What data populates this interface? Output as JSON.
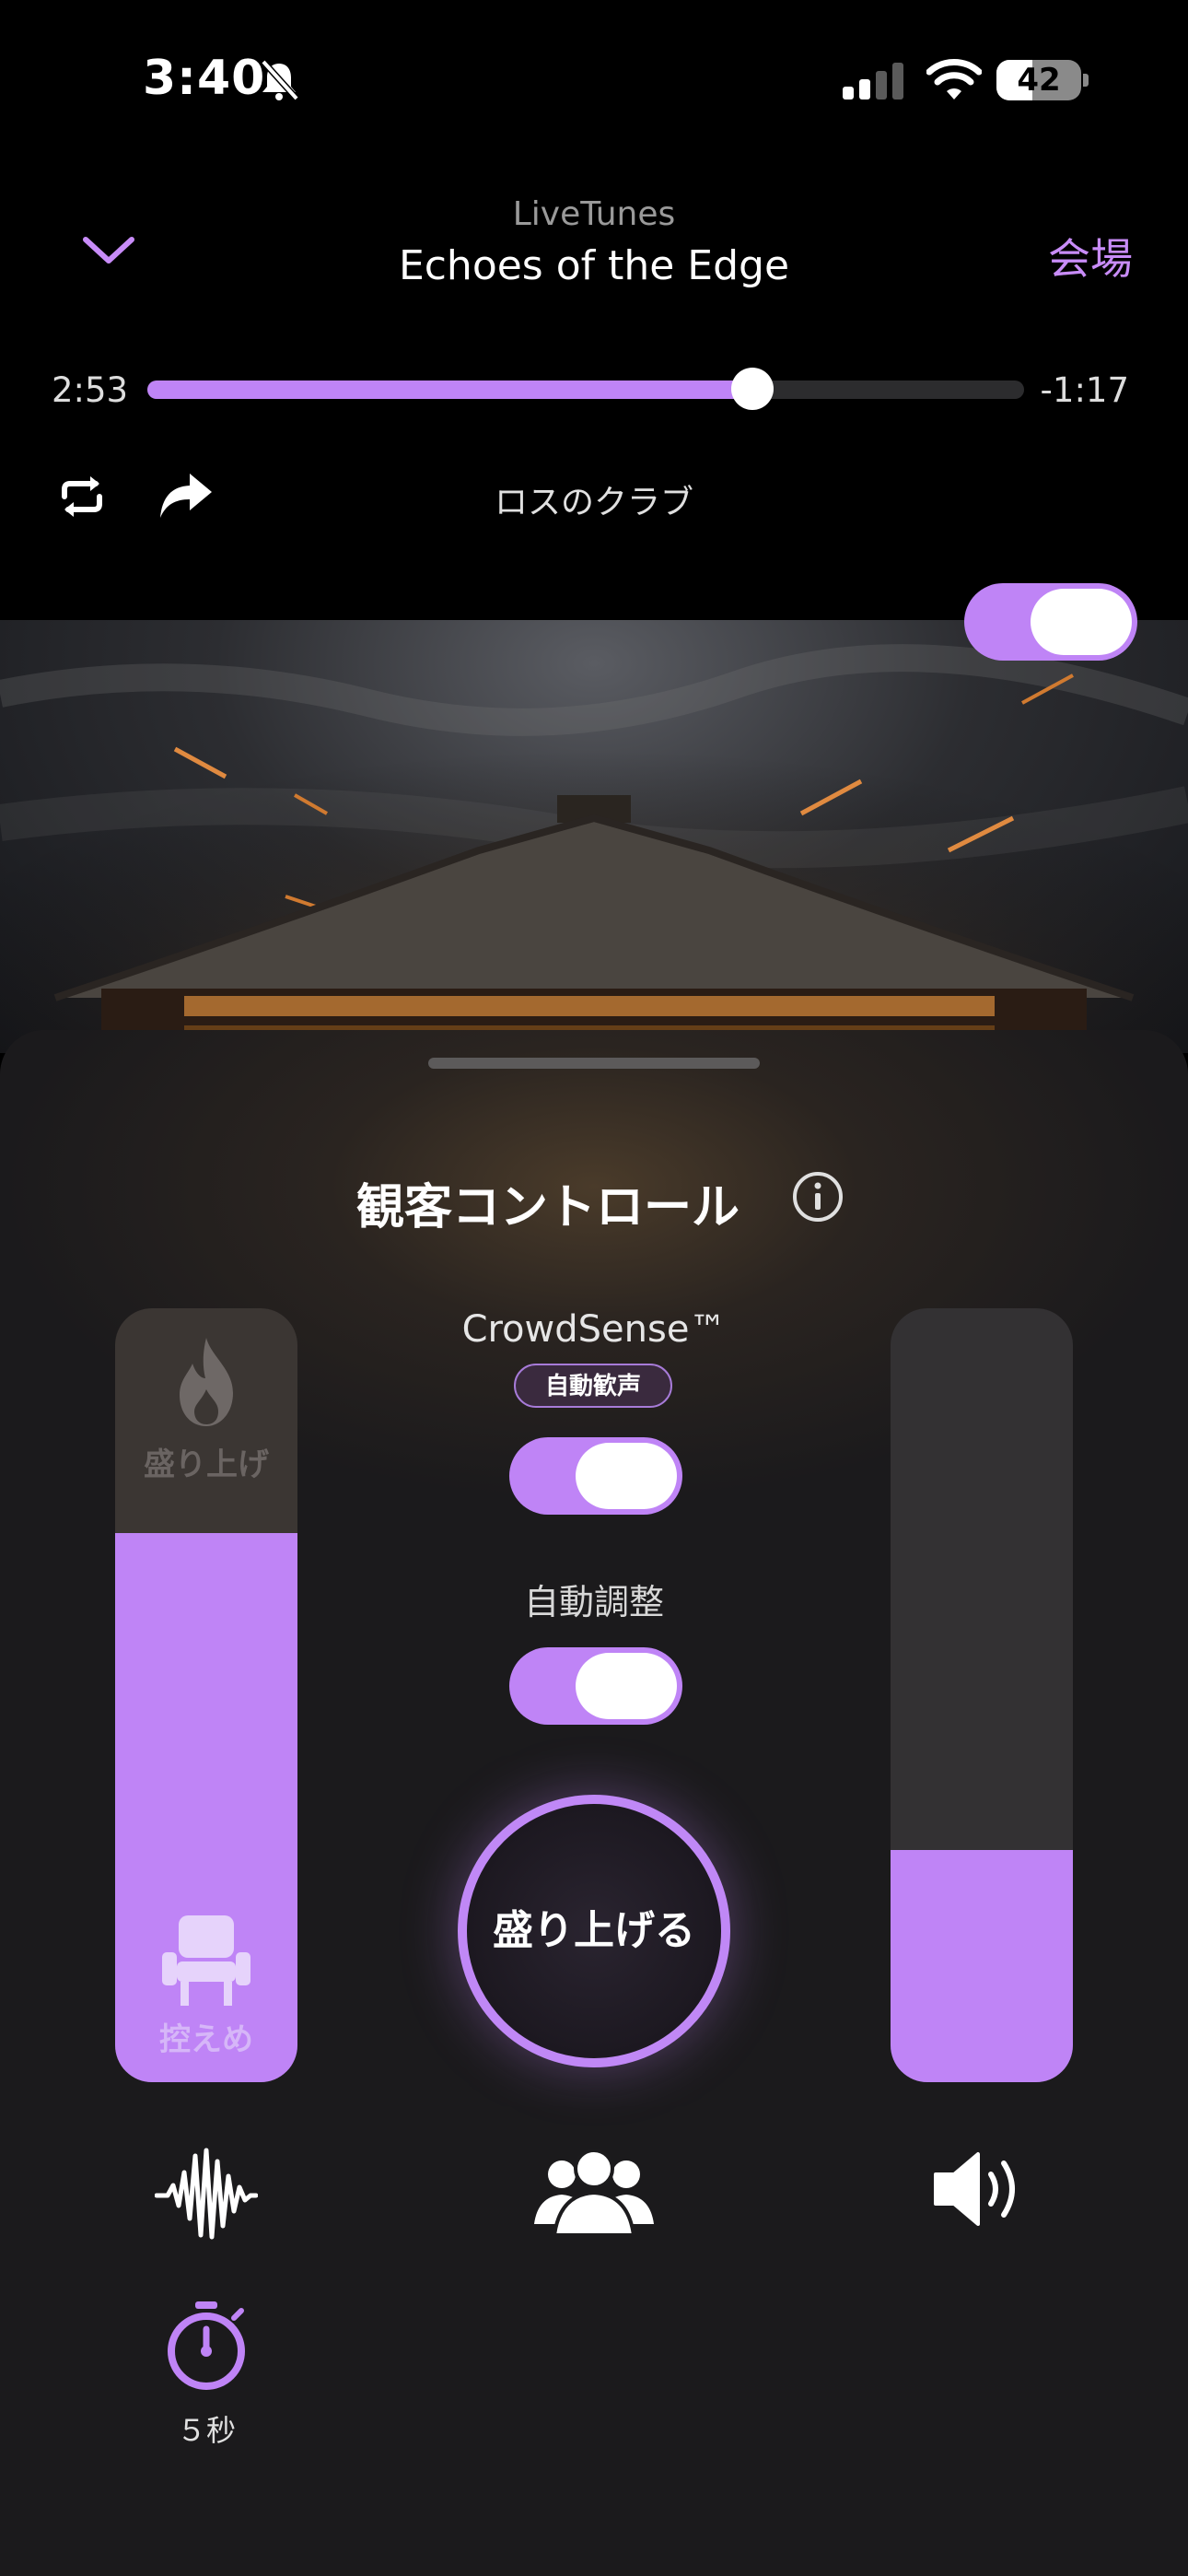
{
  "status_bar": {
    "time": "3:40",
    "battery": "42",
    "battery_level": 0.42
  },
  "header": {
    "app_name": "LiveTunes",
    "track_title": "Echoes of the Edge",
    "venue_link": "会場"
  },
  "playback": {
    "elapsed": "2:53",
    "remaining": "-1:17",
    "progress": 0.69,
    "location": "ロスのクラブ"
  },
  "top_toggle_on": true,
  "panel": {
    "title": "観客コントロール",
    "crowdsense_label": "CrowdSense™",
    "crowdsense_badge": "自動歓声",
    "crowdsense_on": true,
    "auto_adjust_label": "自動調整",
    "auto_adjust_on": true,
    "hype_button": "盛り上げる",
    "intensity_slider": {
      "top_label": "盛り上げ",
      "bottom_label": "控えめ",
      "level": 0.71
    },
    "volume_slider": {
      "level": 0.3
    },
    "timer_label": "５秒"
  },
  "colors": {
    "accent": "#bf84f6",
    "background": "#000000"
  },
  "icons": [
    "bell-slash-icon",
    "signal-icon",
    "wifi-icon",
    "chevron-down-icon",
    "repeat-icon",
    "forward-icon",
    "info-icon",
    "flame-icon",
    "chair-icon",
    "waveform-icon",
    "crowd-icon",
    "speaker-icon",
    "timer-icon"
  ]
}
